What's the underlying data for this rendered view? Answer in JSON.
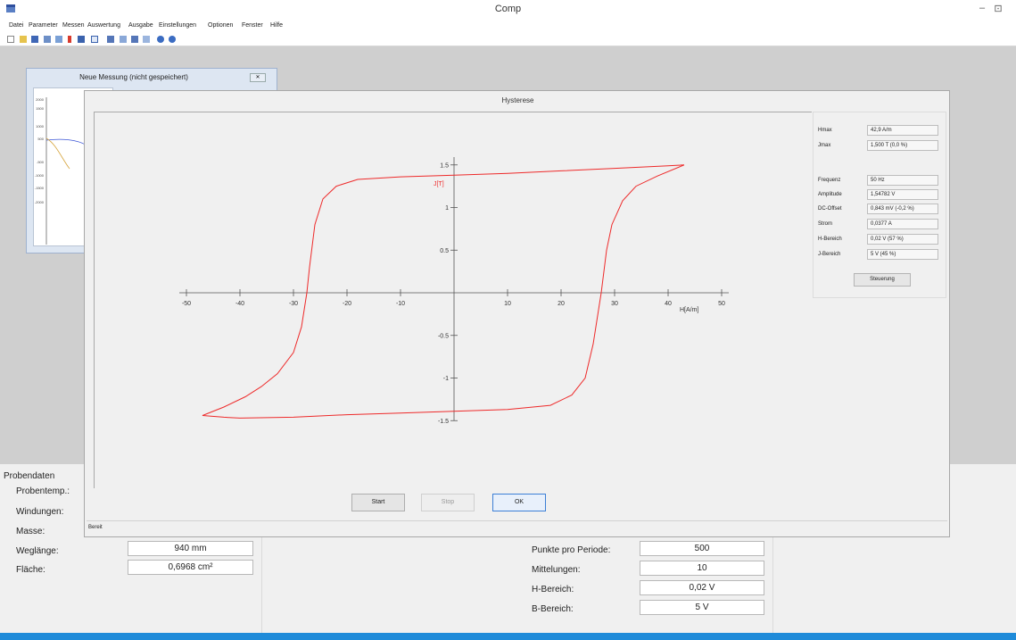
{
  "app": {
    "title": "Comp",
    "window_controls": [
      "–",
      "⊡"
    ]
  },
  "menu": [
    "Datei",
    "Parameter",
    "Messen",
    "Auswertung",
    "Ausgabe",
    "Einstellungen",
    "Optionen",
    "Fenster",
    "Hilfe"
  ],
  "child_window": {
    "title": "Neue Messung (nicht gespeichert)",
    "y_ticks": [
      "2000",
      "1500",
      "1000",
      "500",
      "-500",
      "-1000",
      "-1500",
      "-2000"
    ]
  },
  "dialog": {
    "title": "Hysterese",
    "buttons": {
      "start": "Start",
      "stop": "Stop",
      "ok": "OK"
    },
    "status": "Bereit",
    "params": [
      {
        "label": "Hmax",
        "value": "42,9 A/m"
      },
      {
        "label": "Jmax",
        "value": "1,500 T (0,0 %)"
      },
      {
        "label": "Frequenz",
        "value": "50 Hz"
      },
      {
        "label": "Amplitude",
        "value": "1,54782 V"
      },
      {
        "label": "DC-Offset",
        "value": "0,843 mV (-0,2 %)"
      },
      {
        "label": "Strom",
        "value": "0,0377 A"
      },
      {
        "label": "H-Bereich",
        "value": "0,02 V (57 %)"
      },
      {
        "label": "J-Bereich",
        "value": "5 V (45 %)"
      }
    ],
    "steuerung_label": "Steuerung"
  },
  "chart_data": {
    "type": "line",
    "title": "",
    "xlabel": "H[A/m]",
    "ylabel": "J[T]",
    "xlim": [
      -50,
      50
    ],
    "ylim": [
      -1.5,
      1.5
    ],
    "x_ticks": [
      -50,
      -40,
      -30,
      -20,
      -10,
      10,
      20,
      30,
      40,
      50
    ],
    "x_tick_labels": [
      "-50",
      "-40",
      "-30",
      "-20",
      "-10",
      "10",
      "20",
      "30",
      "40",
      "50"
    ],
    "y_ticks": [
      1.5,
      1,
      0.5,
      -0.5,
      -1,
      -1.5
    ],
    "y_tick_labels": [
      "1.5",
      "1",
      "0.5",
      "-0.5",
      "-1",
      "-1.5"
    ],
    "series_color": "#ee2a2a",
    "series": [
      {
        "values": [
          [
            43,
            1.5
          ],
          [
            40,
            1.49
          ],
          [
            30,
            1.46
          ],
          [
            20,
            1.43
          ],
          [
            10,
            1.4
          ],
          [
            0,
            1.38
          ],
          [
            -10,
            1.36
          ],
          [
            -18,
            1.33
          ],
          [
            -22,
            1.25
          ],
          [
            -24.5,
            1.1
          ],
          [
            -26,
            0.8
          ],
          [
            -27,
            0.3
          ],
          [
            -27.5,
            0
          ],
          [
            -28.5,
            -0.4
          ],
          [
            -30,
            -0.7
          ],
          [
            -33,
            -0.95
          ],
          [
            -36,
            -1.1
          ],
          [
            -39,
            -1.22
          ],
          [
            -43,
            -1.34
          ],
          [
            -47,
            -1.44
          ],
          [
            -43,
            -1.46
          ],
          [
            -40,
            -1.47
          ],
          [
            -30,
            -1.46
          ],
          [
            -20,
            -1.43
          ],
          [
            -10,
            -1.41
          ],
          [
            0,
            -1.39
          ],
          [
            10,
            -1.37
          ],
          [
            18,
            -1.32
          ],
          [
            22,
            -1.2
          ],
          [
            24.5,
            -1.0
          ],
          [
            26,
            -0.6
          ],
          [
            27,
            -0.2
          ],
          [
            27.5,
            0
          ],
          [
            28.5,
            0.5
          ],
          [
            29.5,
            0.8
          ],
          [
            31.5,
            1.08
          ],
          [
            34,
            1.25
          ],
          [
            38,
            1.37
          ],
          [
            43,
            1.5
          ]
        ]
      }
    ]
  },
  "sample_panel": {
    "heading": "Probendaten",
    "left_labels": [
      "Probentemp.:",
      "Windungen:",
      "Masse:",
      "Weglänge:",
      "Fläche:"
    ],
    "weglaenge": "940 mm",
    "flaeche": "0,6968 cm²",
    "right_labels": [
      "Punkte pro Periode:",
      "Mittelungen:",
      "H-Bereich:",
      "B-Bereich:"
    ],
    "right_values": [
      "500",
      "10",
      "0,02 V",
      "5 V"
    ]
  },
  "colors": {
    "accent_statusbar": "#1f8bd9",
    "curve": "#ee2a2a"
  }
}
